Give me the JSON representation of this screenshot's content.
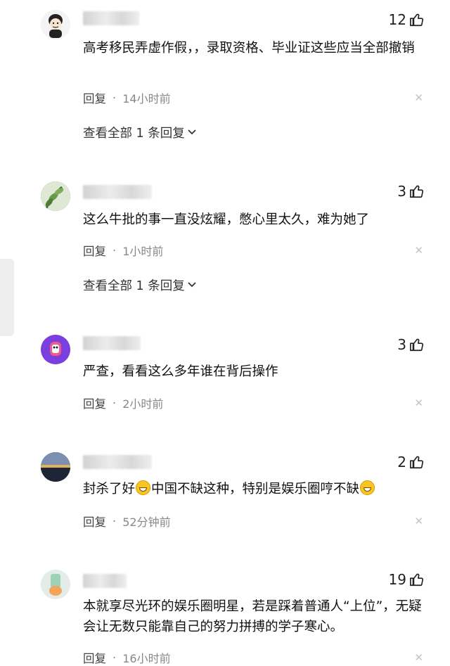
{
  "comments": [
    {
      "likes": "12",
      "text": "高考移民弄虚作假，，录取资格、毕业证这些应当全部撤销",
      "reply_label": "回复",
      "time": "14小时前",
      "view_replies": "查看全部 1 条回复"
    },
    {
      "likes": "3",
      "text": "这么牛批的事一直没炫耀，憋心里太久，难为她了",
      "reply_label": "回复",
      "time": "1小时前",
      "view_replies": "查看全部 1 条回复"
    },
    {
      "likes": "3",
      "text": "严查，看看这么多年谁在背后操作",
      "reply_label": "回复",
      "time": "2小时前"
    },
    {
      "likes": "2",
      "text_a": "封杀了好",
      "text_b": "中国不缺这种，特别是娱乐圈哼不缺",
      "reply_label": "回复",
      "time": "52分钟前"
    },
    {
      "likes": "19",
      "text": "本就享尽光环的娱乐圈明星，若是踩着普通人“上位”，无疑会让无数只能靠自己的努力拼搏的学子寒心。",
      "reply_label": "回复",
      "time": "16小时前"
    }
  ],
  "icons": {
    "like": "thumbs-up-icon",
    "close": "close-icon",
    "chevron": "chevron-down-icon",
    "emoji": "grinning-emoji-icon"
  }
}
